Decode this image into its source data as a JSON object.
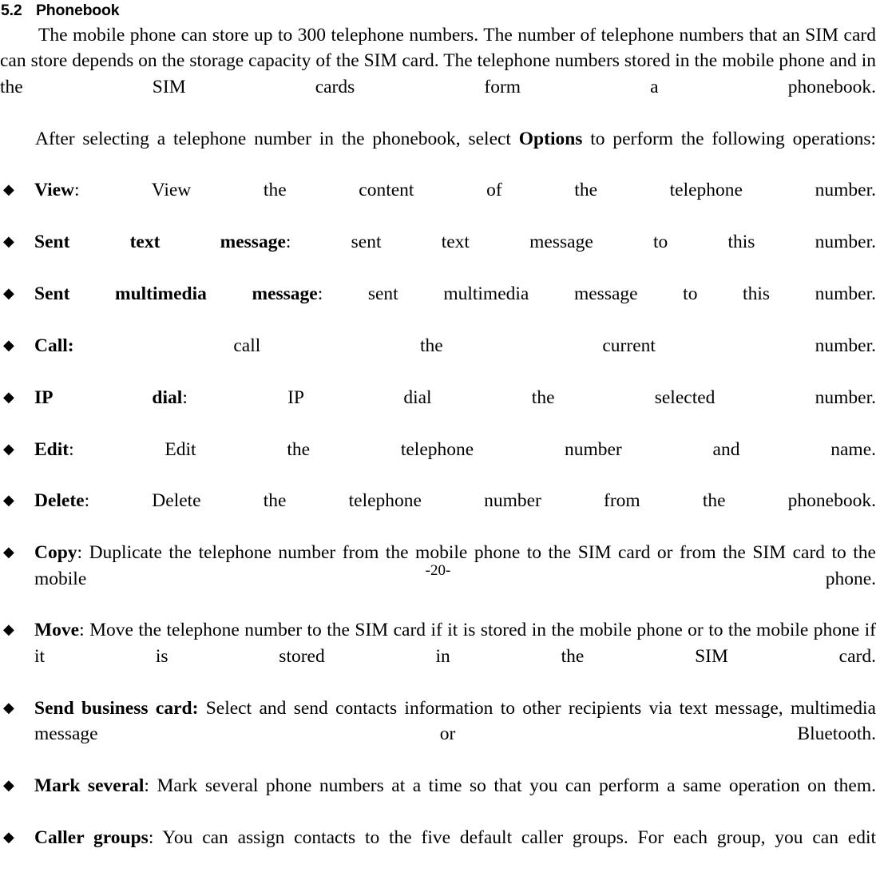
{
  "document": {
    "heading": {
      "number": "5.2",
      "title": "Phonebook"
    },
    "paragraphs": [
      {
        "id": "intro",
        "text": "The mobile phone can store up to 300 telephone numbers. The number of telephone numbers that an SIM card can store depends on the storage capacity of the SIM card. The telephone numbers stored in the mobile phone and in the SIM cards form a phonebook."
      }
    ],
    "options_sentence": {
      "before": "After selecting a telephone number in the phonebook, select ",
      "bold": "Options",
      "after": " to perform the following operations:"
    },
    "bullet_marker": "◆",
    "bullet_marker_name": "diamond-bullet-icon",
    "bullets": [
      {
        "label": "View",
        "sep": ": ",
        "sep_bold": false,
        "text": "View the content of the telephone number."
      },
      {
        "label": "Sent text message",
        "sep": ": ",
        "sep_bold": false,
        "text": "sent text message to this number."
      },
      {
        "label": "Sent multimedia message",
        "sep": ": ",
        "sep_bold": false,
        "text": "sent multimedia message to this number."
      },
      {
        "label": "Call:",
        "sep": " ",
        "sep_bold": true,
        "text": "call the current number."
      },
      {
        "label": "IP dial",
        "sep": ": ",
        "sep_bold": false,
        "text": "IP dial the selected number."
      },
      {
        "label": "Edit",
        "sep": ": ",
        "sep_bold": false,
        "text": "Edit the telephone number and name."
      },
      {
        "label": "Delete",
        "sep": ": ",
        "sep_bold": false,
        "text": "Delete the telephone number from the phonebook."
      },
      {
        "label": "Copy",
        "sep": ": ",
        "sep_bold": false,
        "text": "Duplicate the telephone number from the mobile phone to the SIM card or from the SIM card to the mobile phone."
      },
      {
        "label": "Move",
        "sep": ": ",
        "sep_bold": false,
        "text": "Move the telephone number to the SIM card if it is stored in the mobile phone or to the mobile phone if it is stored in the SIM card."
      },
      {
        "label": "Send business card:",
        "sep": " ",
        "sep_bold": true,
        "text": "Select and send contacts information to other recipients via text message, multimedia message or Bluetooth."
      },
      {
        "label": "Mark several",
        "sep": ": ",
        "sep_bold": false,
        "text": "Mark several phone numbers at a time so that you can perform a same operation on them."
      },
      {
        "label": "Caller groups",
        "sep": ": ",
        "sep_bold": false,
        "text": "You can assign contacts to the five default caller groups. For each group, you can edit"
      }
    ],
    "footer": {
      "page_number": "-20-"
    }
  },
  "colors": {
    "page_background": "#ffffff",
    "text": "#000000"
  }
}
